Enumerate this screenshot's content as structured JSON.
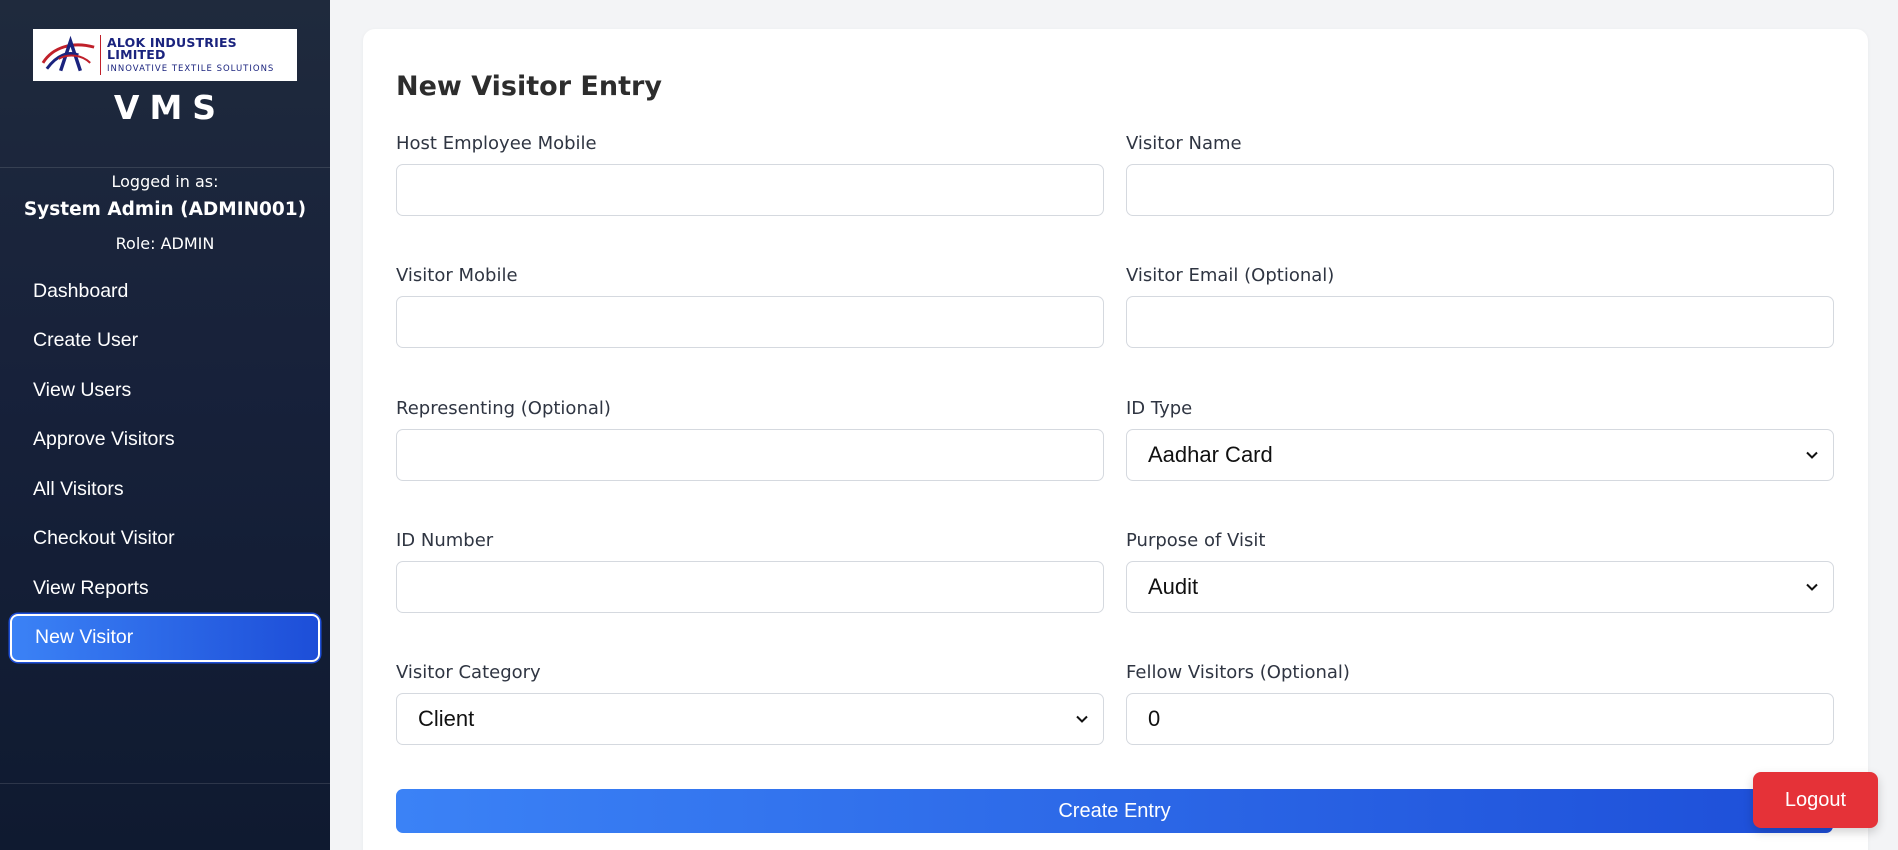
{
  "brand": {
    "company": "ALOK INDUSTRIES LIMITED",
    "tagline": "INNOVATIVE TEXTILE SOLUTIONS",
    "app_name": "VMS",
    "logo_icon": "alok-swoosh-logo"
  },
  "user": {
    "logged_in_label": "Logged in as:",
    "name": "System Admin (ADMIN001)",
    "role": "Role: ADMIN"
  },
  "sidebar": {
    "items": [
      {
        "label": "Dashboard"
      },
      {
        "label": "Create User"
      },
      {
        "label": "View Users"
      },
      {
        "label": "Approve Visitors"
      },
      {
        "label": "All Visitors"
      },
      {
        "label": "Checkout Visitor"
      },
      {
        "label": "View Reports"
      },
      {
        "label": "New Visitor",
        "active": true
      }
    ]
  },
  "form": {
    "title": "New Visitor Entry",
    "host_mobile": {
      "label": "Host Employee Mobile",
      "value": ""
    },
    "visitor_name": {
      "label": "Visitor Name",
      "value": ""
    },
    "visitor_mobile": {
      "label": "Visitor Mobile",
      "value": ""
    },
    "visitor_email": {
      "label": "Visitor Email (Optional)",
      "value": ""
    },
    "representing": {
      "label": "Representing (Optional)",
      "value": ""
    },
    "id_type": {
      "label": "ID Type",
      "selected": "Aadhar Card"
    },
    "id_number": {
      "label": "ID Number",
      "value": ""
    },
    "purpose": {
      "label": "Purpose of Visit",
      "selected": "Audit"
    },
    "category": {
      "label": "Visitor Category",
      "selected": "Client"
    },
    "fellow_visitors": {
      "label": "Fellow Visitors (Optional)",
      "value": "0"
    },
    "submit_label": "Create Entry"
  },
  "logout_label": "Logout",
  "colors": {
    "accent": "#2563eb",
    "sidebar_bg": "#17213a",
    "logout": "#e53238"
  }
}
